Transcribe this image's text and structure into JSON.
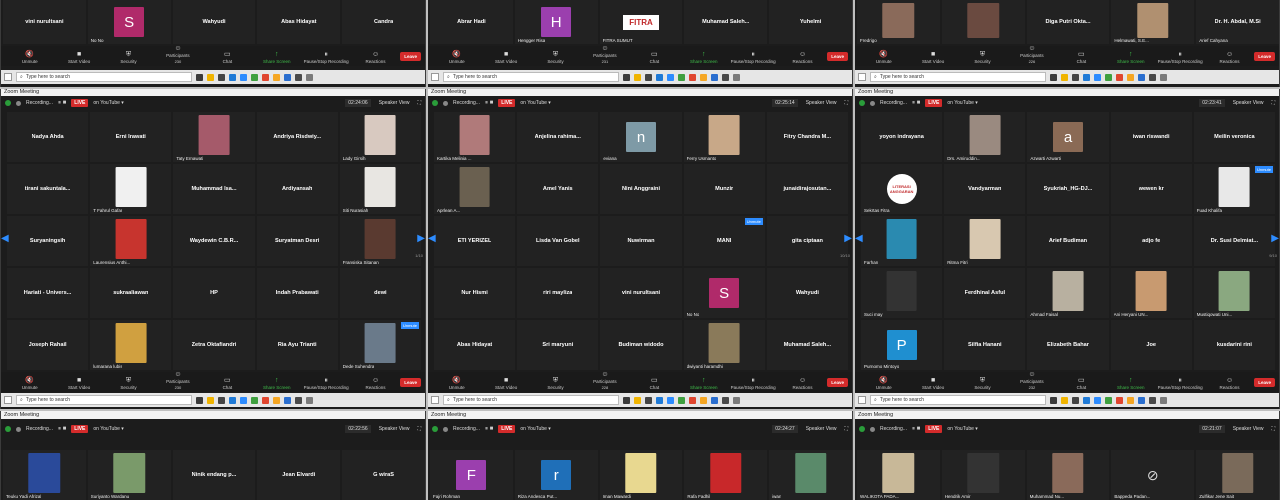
{
  "app_title": "Zoom Meeting",
  "controls": {
    "unmute": "Unmute",
    "start_video": "Start Video",
    "security": "Security",
    "participants": "Participants",
    "chat": "Chat",
    "share": "Share Screen",
    "record": "Pause/Stop Recording",
    "reactions": "Reactions",
    "leave": "Leave"
  },
  "recording": "Recording...",
  "live": "LIVE",
  "on_youtube": "on YouTube ▾",
  "speaker_view": "Speaker View",
  "search_placeholder": "Type here to search",
  "top": [
    {
      "count": "230",
      "row": [
        "vini nurultsani",
        "S",
        "Wahyudi",
        "Abas Hidayat",
        "Candra"
      ],
      "sub": [
        "",
        "No No",
        "",
        "",
        ""
      ]
    },
    {
      "count": "231",
      "row": [
        "Abrar Hadi",
        "H",
        "FITRA",
        "Muhamad Saleh...",
        "Yuhelmi"
      ],
      "sub": [
        "",
        "Hengger Risa",
        "FITRA SUMUT",
        "",
        ""
      ]
    },
    {
      "count": "226",
      "row": [
        "",
        "",
        "Diga Putri Okta...",
        "",
        "Dr. H. Abdal, M.Si"
      ],
      "sub": [
        "Fredrigo",
        "",
        "",
        "Helmawati, S.E...",
        "Arief Cahyana"
      ]
    }
  ],
  "mid": [
    {
      "timer": "02:24:06",
      "count": "230",
      "page": "1/10",
      "rows": [
        [
          {
            "n": "Nadya Ahda"
          },
          {
            "n": "Erni Irawati"
          },
          {
            "n": "",
            "s": "Taty Ernawati",
            "p": "#a55a6a"
          },
          {
            "n": "Andriya Risdwiy..."
          },
          {
            "n": "",
            "s": "Lady Girsih",
            "p": "#d8c9c0"
          }
        ],
        [
          {
            "n": "tirani sakuntala..."
          },
          {
            "n": "",
            "s": "T Fahrul Gafar",
            "p": "#f0f0f0"
          },
          {
            "n": "Muhammad Isa..."
          },
          {
            "n": "Ardiyansah"
          },
          {
            "n": "",
            "s": "Siti Nurasiah",
            "p": "#e8e6e2"
          }
        ],
        [
          {
            "n": "Suryaningsih"
          },
          {
            "n": "",
            "s": "Laurensius Anthi...",
            "p": "#c7342e"
          },
          {
            "n": "Waydewin C.B.R..."
          },
          {
            "n": "Suryatman Desri"
          },
          {
            "n": "",
            "s": "Fransiska Sitanan",
            "p": "#5a3a30"
          }
        ],
        [
          {
            "n": "Hariati - Univers..."
          },
          {
            "n": "sukraaliawan"
          },
          {
            "n": "HP"
          },
          {
            "n": "Indah Prabawati"
          },
          {
            "n": "dewi"
          }
        ],
        [
          {
            "n": "Joseph Rahail"
          },
          {
            "n": "",
            "s": "lumarana lubis",
            "p": "#d0a040"
          },
          {
            "n": "Zetra Oktafiandri"
          },
          {
            "n": "Ria Ayu Trianti"
          },
          {
            "n": "",
            "s": "Dede Suhendra",
            "p": "#6a7a8a",
            "u": "Unmute"
          }
        ]
      ]
    },
    {
      "timer": "02:25:14",
      "count": "228",
      "page": "10/10",
      "rows": [
        [
          {
            "n": "",
            "s": "Kartika Melinia ...",
            "p": "#b07a7a"
          },
          {
            "n": "Anjelina rahima..."
          },
          {
            "n": "",
            "s": "eviana",
            "l": "n",
            "c": "#7e9aa6"
          },
          {
            "n": "",
            "s": "Ferry Usmanto",
            "p": "#c8a888"
          },
          {
            "n": "Fitry Chandra M..."
          }
        ],
        [
          {
            "n": "",
            "s": "Aprlean A...",
            "p": "#6a6050"
          },
          {
            "n": "Amel Yanis"
          },
          {
            "n": "Nini Anggraini"
          },
          {
            "n": "Munzir"
          },
          {
            "n": "junaidirajosutan..."
          }
        ],
        [
          {
            "n": "ETI YERIZEL"
          },
          {
            "n": "Lisda Van Gobel"
          },
          {
            "n": "Nuwirman"
          },
          {
            "n": "MANI",
            "u": "Unmute"
          },
          {
            "n": "gita ciptaan"
          }
        ],
        [
          {
            "n": "Nur Hismi"
          },
          {
            "n": "riri mayliza"
          },
          {
            "n": "vini nurultsani"
          },
          {
            "n": "",
            "s": "No No",
            "l": "S",
            "c": "#b02a6a"
          },
          {
            "n": "Wahyudi"
          }
        ],
        [
          {
            "n": "Abas Hidayat"
          },
          {
            "n": "Sri maryuni"
          },
          {
            "n": "Budiman widodo"
          },
          {
            "n": "",
            "s": "dwiyanti haramdhi",
            "p": "#8a7a5a"
          },
          {
            "n": "Muhamad Saleh..."
          }
        ]
      ]
    },
    {
      "timer": "02:23:41",
      "count": "232",
      "page": "9/10",
      "rows": [
        [
          {
            "n": "yoyon indrayana"
          },
          {
            "n": "",
            "s": "Drs. Amiruddin...",
            "p": "#9a8a80"
          },
          {
            "n": "",
            "s": "Azwarti Azwarti",
            "l": "a",
            "c": "#8a6a55"
          },
          {
            "n": "iwan riswandi"
          },
          {
            "n": "Meilin veronica"
          }
        ],
        [
          {
            "n": "",
            "s": "Sekrtas Fitra",
            "lg": "LITERASI ANGGARAN"
          },
          {
            "n": "Vandyarman"
          },
          {
            "n": "Syukriah_HG-DJ..."
          },
          {
            "n": "wewen kr"
          },
          {
            "n": "",
            "s": "Fuad Khalifa",
            "p": "#e8e8e8",
            "u": "Unmute"
          }
        ],
        [
          {
            "n": "",
            "s": "Farhan",
            "p": "#2a8ab0"
          },
          {
            "n": "",
            "s": "Ritma Fitri",
            "p": "#d8c8b0"
          },
          {
            "n": "Arief Budiman"
          },
          {
            "n": "adjo fe"
          },
          {
            "n": "Dr. Susi Delmiat..."
          }
        ],
        [
          {
            "n": "",
            "s": "Suci may",
            "p": "#333"
          },
          {
            "n": "Ferdhinal Asful"
          },
          {
            "n": "",
            "s": "Ahmad Faisal",
            "p": "#b8b0a0"
          },
          {
            "n": "",
            "s": "Ani Heryani UN...",
            "p": "#c89a70"
          },
          {
            "n": "",
            "s": "Mustiqowati Uni...",
            "p": "#8aa880"
          }
        ],
        [
          {
            "n": "",
            "s": "Purnomo Mintoyo",
            "l": "P",
            "c": "#1f8fd0"
          },
          {
            "n": "Silfia Hanani"
          },
          {
            "n": "Elizabeth Bahar"
          },
          {
            "n": "Joe"
          },
          {
            "n": "kusdarini rini"
          }
        ]
      ]
    }
  ],
  "bot": [
    {
      "timer": "02:22:56",
      "row": [
        {
          "n": "",
          "s": "Teuku Yadi Afrizal",
          "p": "#2a4a9a"
        },
        {
          "n": "",
          "s": "Suriyanto Wardanu",
          "p": "#7a9a6a"
        },
        {
          "n": "Ninik endang p..."
        },
        {
          "n": "Jean Elvardi"
        },
        {
          "n": "G wiraS"
        }
      ]
    },
    {
      "timer": "02:24:27",
      "row": [
        {
          "n": "",
          "s": "Fajri Rohman",
          "l": "F",
          "c": "#9b3fae"
        },
        {
          "n": "",
          "s": "Riza Andesca Put...",
          "l": "r",
          "c": "#1f6fb8"
        },
        {
          "n": "",
          "s": "Iman Mawardi",
          "p": "#e8d890"
        },
        {
          "n": "",
          "s": "Rafa Fadhil",
          "p": "#c8282a"
        },
        {
          "n": "",
          "s": "iwan",
          "p": "#5a8a6a"
        }
      ]
    },
    {
      "timer": "02:21:07",
      "row": [
        {
          "n": "",
          "s": "WALIKOTA PADA...",
          "p": "#c8b898"
        },
        {
          "n": "",
          "s": "Hendrik Amir",
          "p": "#333"
        },
        {
          "n": "",
          "s": "Muhammad Nu...",
          "p": "#8a6a5a"
        },
        {
          "n": "",
          "s": "Bappeda Padan...",
          "cam": "1"
        },
        {
          "n": "",
          "s": "Zulfikar Jene Sait",
          "p": "#7a6a5a"
        }
      ]
    }
  ]
}
